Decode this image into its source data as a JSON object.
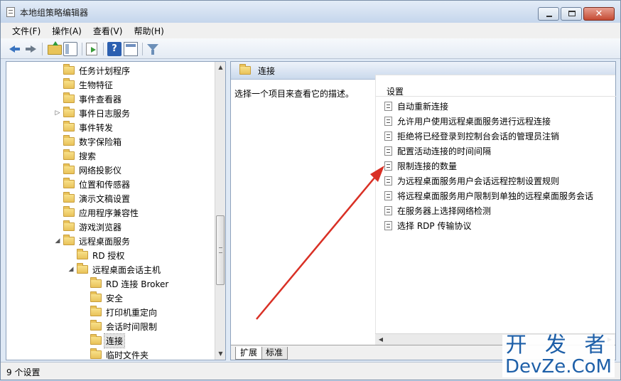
{
  "window": {
    "title": "本地组策略编辑器"
  },
  "menu": [
    {
      "label": "文件(F)"
    },
    {
      "label": "操作(A)"
    },
    {
      "label": "查看(V)"
    },
    {
      "label": "帮助(H)"
    }
  ],
  "tree": {
    "items": [
      {
        "label": "任务计划程序",
        "level": 0,
        "expander": ""
      },
      {
        "label": "生物特征",
        "level": 0,
        "expander": ""
      },
      {
        "label": "事件查看器",
        "level": 0,
        "expander": ""
      },
      {
        "label": "事件日志服务",
        "level": 0,
        "expander": "▷"
      },
      {
        "label": "事件转发",
        "level": 0,
        "expander": ""
      },
      {
        "label": "数字保险箱",
        "level": 0,
        "expander": ""
      },
      {
        "label": "搜索",
        "level": 0,
        "expander": ""
      },
      {
        "label": "网络投影仪",
        "level": 0,
        "expander": ""
      },
      {
        "label": "位置和传感器",
        "level": 0,
        "expander": ""
      },
      {
        "label": "演示文稿设置",
        "level": 0,
        "expander": ""
      },
      {
        "label": "应用程序兼容性",
        "level": 0,
        "expander": ""
      },
      {
        "label": "游戏浏览器",
        "level": 0,
        "expander": ""
      },
      {
        "label": "远程桌面服务",
        "level": 0,
        "expander": "◢"
      },
      {
        "label": "RD 授权",
        "level": 1,
        "expander": ""
      },
      {
        "label": "远程桌面会话主机",
        "level": 1,
        "expander": "◢"
      },
      {
        "label": "RD 连接 Broker",
        "level": 2,
        "expander": ""
      },
      {
        "label": "安全",
        "level": 2,
        "expander": ""
      },
      {
        "label": "打印机重定向",
        "level": 2,
        "expander": ""
      },
      {
        "label": "会话时间限制",
        "level": 2,
        "expander": ""
      },
      {
        "label": "连接",
        "level": 2,
        "expander": "",
        "selected": true
      },
      {
        "label": "临时文件夹",
        "level": 2,
        "expander": ""
      }
    ]
  },
  "right": {
    "header_title": "连接",
    "description": "选择一个项目来查看它的描述。",
    "column_header": "设置",
    "settings": [
      "自动重新连接",
      "允许用户使用远程桌面服务进行远程连接",
      "拒绝将已经登录到控制台会话的管理员注销",
      "配置活动连接的时间间隔",
      "限制连接的数量",
      "为远程桌面服务用户会话远程控制设置规则",
      "将远程桌面服务用户限制到单独的远程桌面服务会话",
      "在服务器上选择网络检测",
      "选择 RDP 传输协议"
    ],
    "tabs": [
      {
        "label": "扩展",
        "active": true
      },
      {
        "label": "标准",
        "active": false
      }
    ]
  },
  "status": {
    "text": "9 个设置"
  },
  "watermark": {
    "line1": "开 发 者",
    "line2": "DevZe.CoM"
  },
  "icons": {
    "back": "arrow-left-icon",
    "forward": "arrow-right-icon",
    "up": "folder-up-icon",
    "tree": "console-tree-icon",
    "export": "export-list-icon",
    "help": "help-icon",
    "properties": "properties-icon",
    "filter": "filter-icon"
  },
  "colors": {
    "annotation_arrow": "#d93025",
    "accent": "#3a74c0"
  }
}
